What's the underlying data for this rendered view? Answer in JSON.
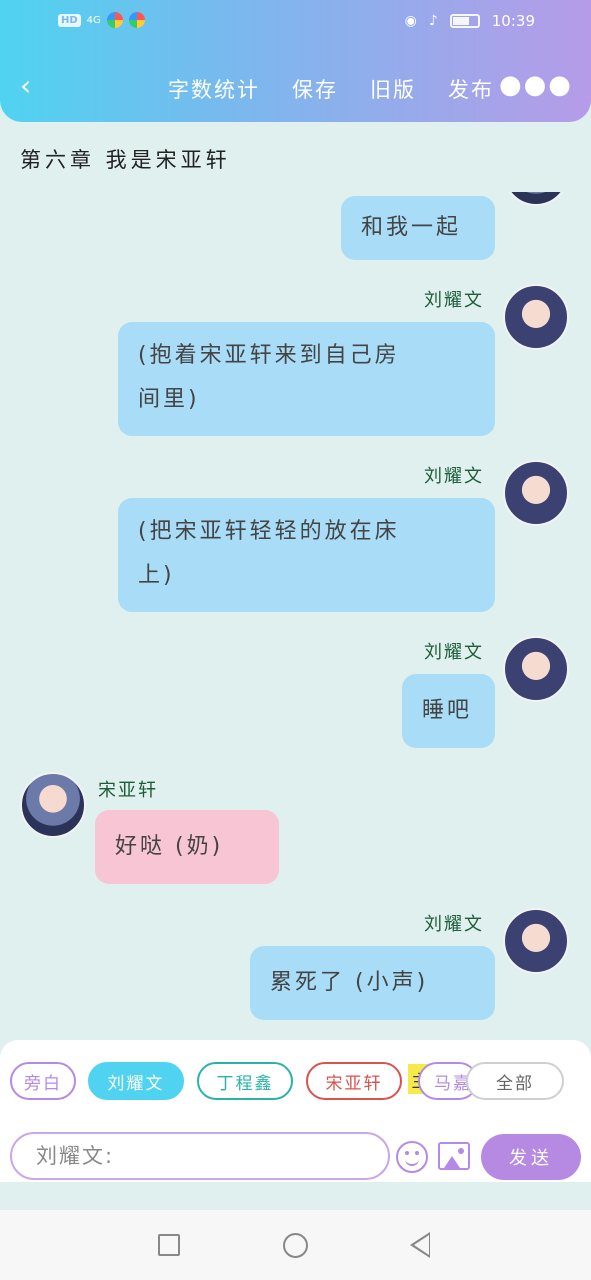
{
  "status_bar": {
    "network_label": "HD",
    "signal_label": "4G",
    "time": "10:39"
  },
  "header": {
    "back_icon": "chevron-left-icon",
    "nav": [
      "字数统计",
      "保存",
      "旧版",
      "发布"
    ],
    "more_icon": "more-dots-icon",
    "colors": {
      "gradient_start": "#4fd3f0",
      "gradient_end": "#b69be8"
    }
  },
  "chapter_title": "第六章  我是宋亚轩",
  "messages": [
    {
      "sender": "",
      "text": "和我一起",
      "side": "right"
    },
    {
      "sender": "刘耀文",
      "text": "(抱着宋亚轩来到自己房间里)",
      "line1": "(抱着宋亚轩来到自己房",
      "line2": "间里)",
      "side": "right"
    },
    {
      "sender": "刘耀文",
      "text": "(把宋亚轩轻轻的放在床上)",
      "line1": "(把宋亚轩轻轻的放在床",
      "line2": "上)",
      "side": "right"
    },
    {
      "sender": "刘耀文",
      "text": "睡吧",
      "side": "right"
    },
    {
      "sender": "宋亚轩",
      "text": "好哒 (奶)",
      "side": "left"
    },
    {
      "sender": "刘耀文",
      "text": "累死了 (小声)",
      "side": "right"
    }
  ],
  "roles": [
    {
      "label": "旁白",
      "selected": false,
      "color": "#b38ae6"
    },
    {
      "label": "刘耀文",
      "selected": true,
      "color": "#4fd3f0"
    },
    {
      "label": "丁程鑫",
      "selected": false,
      "color": "#2bb3a8"
    },
    {
      "label": "宋亚轩",
      "selected": false,
      "color": "#d9534f"
    },
    {
      "label": "马嘉",
      "selected": false,
      "color": "#b38ae6"
    }
  ],
  "role_marker": "主",
  "all_label": "全部",
  "input": {
    "placeholder": "刘耀文:"
  },
  "send_label": "发送",
  "bottom_icons": [
    "smile-icon",
    "image-icon"
  ],
  "system_nav": [
    "square-icon",
    "circle-icon",
    "back-triangle-icon"
  ]
}
